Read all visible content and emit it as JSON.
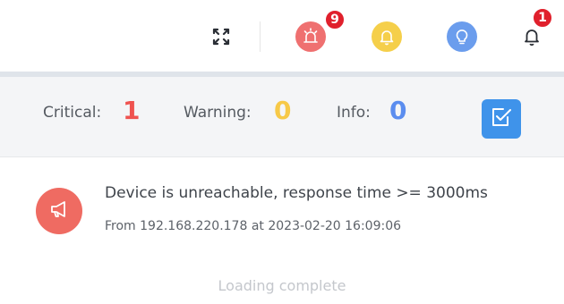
{
  "toolbar": {
    "fullscreen_icon": "fullscreen-icon",
    "alarm_icon": "siren-icon",
    "alarm_badge": "9",
    "warning_icon": "bell-icon",
    "info_icon": "lightbulb-icon",
    "notification_icon": "bell-outline-icon",
    "notification_badge": "1"
  },
  "summary": {
    "critical_label": "Critical:",
    "critical_value": "1",
    "warning_label": "Warning:",
    "warning_value": "0",
    "info_label": "Info:",
    "info_value": "0",
    "mark_read_icon": "checkbox-icon"
  },
  "alerts": [
    {
      "icon": "megaphone-icon",
      "title": "Device is unreachable, response time >= 3000ms",
      "detail": "From 192.168.220.178 at 2023-02-20 16:09:06"
    }
  ],
  "footer": {
    "status": "Loading complete"
  },
  "colors": {
    "critical": "#ef5350",
    "warning": "#f7c948",
    "info": "#5b8def",
    "alarm_button": "#ef7070",
    "warning_button": "#f5cf4a",
    "info_button": "#6b9ded",
    "accent_blue": "#3f93ea",
    "badge_red": "#e0202c"
  }
}
